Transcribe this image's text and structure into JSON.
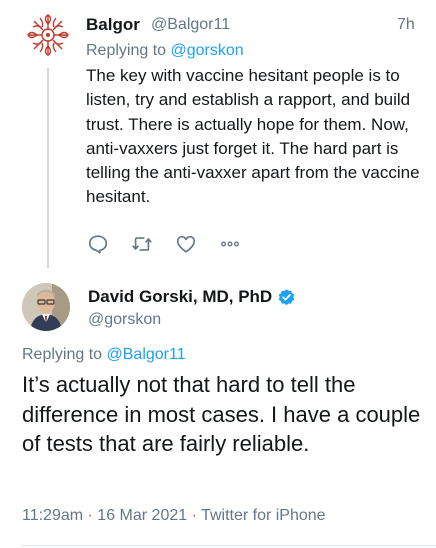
{
  "parent_tweet": {
    "display_name": "Balgor",
    "handle": "@Balgor11",
    "time": "7h",
    "replying_prefix": "Replying to ",
    "replying_to": "@gorskon",
    "body": "The key with vaccine hesitant people is to listen, try and establish a rapport, and build trust.  There is actually hope for them.  Now, anti-vaxxers just forget it.  The hard part is telling the anti-vaxxer apart from the vaccine hesitant.",
    "actions": [
      "reply-icon",
      "retweet-icon",
      "like-icon",
      "more-icon"
    ]
  },
  "main_tweet": {
    "display_name": "David Gorski, MD, PhD",
    "verified": true,
    "handle": "@gorskon",
    "replying_prefix": "Replying to ",
    "replying_to": "@Balgor11",
    "body": "It’s actually not that hard to tell the difference in most cases. I have a couple of tests that are fairly reliable.",
    "meta": "11:29am · 16 Mar 2021 · Twitter for iPhone"
  },
  "colors": {
    "accent": "#1da1f2",
    "secondary_text": "#657786",
    "primary_text": "#14171a",
    "avatar_pattern": "#c0392b"
  }
}
